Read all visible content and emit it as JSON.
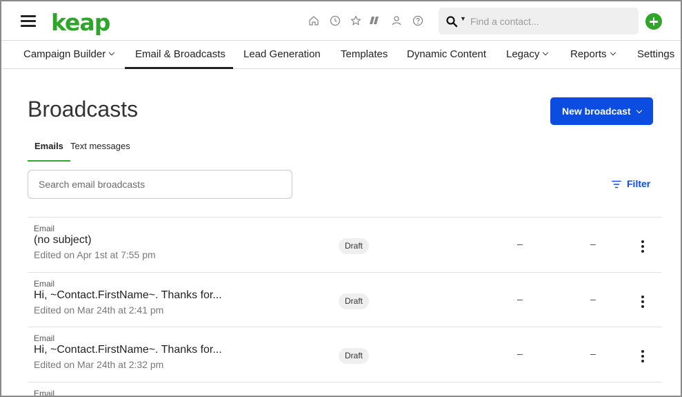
{
  "header": {
    "logo_text": "keap",
    "brand_color": "#2fa52b",
    "accent_color": "#0a4de0",
    "icons": [
      "home-icon",
      "history-icon",
      "star-icon",
      "tags-icon",
      "contact-icon",
      "help-icon"
    ],
    "search": {
      "placeholder": "Find a contact..."
    }
  },
  "nav": {
    "items": [
      {
        "label": "Campaign Builder",
        "has_dropdown": true,
        "active": false
      },
      {
        "label": "Email & Broadcasts",
        "has_dropdown": false,
        "active": true
      },
      {
        "label": "Lead Generation",
        "has_dropdown": false,
        "active": false
      },
      {
        "label": "Templates",
        "has_dropdown": false,
        "active": false
      },
      {
        "label": "Dynamic Content",
        "has_dropdown": false,
        "active": false
      },
      {
        "label": "Legacy",
        "has_dropdown": true,
        "active": false
      },
      {
        "label": "Reports",
        "has_dropdown": true,
        "active": false
      },
      {
        "label": "Settings",
        "has_dropdown": false,
        "active": false
      }
    ]
  },
  "main": {
    "title": "Broadcasts",
    "new_button_label": "New broadcast",
    "tabs": [
      {
        "label": "Emails",
        "active": true
      },
      {
        "label": "Text messages",
        "active": false
      }
    ],
    "search": {
      "placeholder": "Search email broadcasts"
    },
    "filter_label": "Filter"
  },
  "broadcasts": [
    {
      "type": "Email",
      "subject": "(no subject)",
      "edited": "Edited on Apr 1st at 7:55 pm",
      "status": "Draft",
      "col1": "–",
      "col2": "–"
    },
    {
      "type": "Email",
      "subject": "Hi, ~Contact.FirstName~. Thanks for...",
      "edited": "Edited on Mar 24th at 2:41 pm",
      "status": "Draft",
      "col1": "–",
      "col2": "–"
    },
    {
      "type": "Email",
      "subject": "Hi, ~Contact.FirstName~. Thanks for...",
      "edited": "Edited on Mar 24th at 2:32 pm",
      "status": "Draft",
      "col1": "–",
      "col2": "–"
    },
    {
      "type": "Email"
    }
  ]
}
